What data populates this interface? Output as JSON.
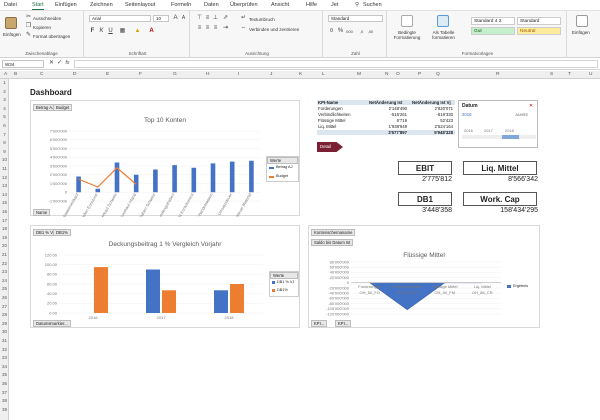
{
  "menu": [
    "Datei",
    "Start",
    "Einfügen",
    "Zeichnen",
    "Seitenlayout",
    "Formeln",
    "Daten",
    "Überprüfen",
    "Ansicht",
    "Hilfe",
    "Jet"
  ],
  "search": "Suchen",
  "ribbon": {
    "paste": "Einfügen",
    "cut": "Ausschneiden",
    "copy": "Kopieren",
    "format_painter": "Format übertragen",
    "clipboard": "Zwischenablage",
    "font": "Arial",
    "font_size": "10",
    "font_group": "Schriftart",
    "wrap": "Textumbruch",
    "merge": "Verbinden und zentrieren",
    "alignment": "Ausrichtung",
    "number_format": "Standard",
    "number": "Zahl",
    "cond_format": "Bedingte Formatierung",
    "as_table": "Als Tabelle formatieren",
    "styles": [
      "Standard 4 2",
      "Standard",
      "Gut",
      "Neutral"
    ],
    "styles_group": "Formatvorlagen",
    "insert": "Einfügen"
  },
  "name_box": "W34",
  "columns": [
    "A",
    "B",
    "C",
    "D",
    "E",
    "F",
    "G",
    "H",
    "I",
    "J",
    "K",
    "L",
    "M",
    "N",
    "O",
    "P",
    "Q",
    "R",
    "S",
    "T",
    "U"
  ],
  "rows": [
    "1",
    "2",
    "3",
    "4",
    "5",
    "6",
    "7",
    "8",
    "9",
    "10",
    "11",
    "12",
    "13",
    "14",
    "15",
    "16",
    "17",
    "18",
    "19",
    "20",
    "21",
    "22",
    "23",
    "24",
    "25",
    "26",
    "27",
    "28",
    "29",
    "30",
    "31",
    "32",
    "33",
    "34",
    "35",
    "36",
    "37",
    "38",
    "39"
  ],
  "title": "Dashboard",
  "chart1": {
    "buttons": [
      "Betrag AJ",
      "Budget"
    ],
    "title": "Top 10 Konten",
    "legend_title": "Werte",
    "legend": [
      "Betrag AJ",
      "Budget"
    ],
    "filter": "Name",
    "chart_data": {
      "type": "bar",
      "categories": [
        "Handelswareneinkauf",
        "Kostenstellen Eurozone",
        "Warenverkauf Schweiz",
        "Warenverkauf Inland",
        "Kundenguthaben Schweiz",
        "Bank Kundenguthaben",
        "Umsatz Kontokorrent",
        "Vorräte Handelswaren",
        "Umsatzsteuer",
        "Vorsteuer Material"
      ],
      "yticks": [
        "7'000'000",
        "6'000'000",
        "5'000'000",
        "4'000'000",
        "3'000'000",
        "2'000'000",
        "1'000'000",
        "0",
        "-1'000'000"
      ],
      "series": [
        {
          "name": "Betrag AJ",
          "type": "bar",
          "values": [
            1800000,
            400000,
            3400000,
            2000000,
            2600000,
            3100000,
            2800000,
            3300000,
            3500000,
            3600000
          ]
        },
        {
          "name": "Budget",
          "type": "line",
          "values": [
            1500000,
            600000,
            2800000,
            900000,
            null,
            null,
            null,
            null,
            null,
            null
          ]
        }
      ],
      "ylim": [
        -1000000,
        7000000
      ]
    }
  },
  "pivot": {
    "headers": [
      "KPI-Name",
      "NetÄnderung Ist",
      "NetÄnderung Ist Vj"
    ],
    "rows": [
      [
        "Forderungen",
        "2'148'490",
        "2'820'071"
      ],
      [
        "Verbindlichkeiten",
        "-516'261",
        "-619'330"
      ],
      [
        "Flüssige Mittel",
        "6'719",
        "52'423"
      ],
      [
        "Liq. Mittel",
        "1'938'949",
        "2'524'164"
      ]
    ],
    "total": [
      "",
      "3'577'897",
      "5'948'328"
    ]
  },
  "detail": "Detail",
  "date_slicer": {
    "title": "Datum",
    "value": "2018",
    "level": "JAHRE",
    "years": [
      "2016",
      "2017",
      "2018"
    ]
  },
  "kpis": [
    {
      "label": "EBIT",
      "value": "2'775'812"
    },
    {
      "label": "Liq. Mittel",
      "value": "8'566'342"
    },
    {
      "label": "DB1",
      "value": "3'448'358"
    },
    {
      "label": "Work. Cap",
      "value": "158'434'295"
    }
  ],
  "chart2": {
    "buttons": [
      "DB1 % VJ",
      "DB1%"
    ],
    "title": "Deckungsbeitrag 1 % Vergleich Vorjahr",
    "legend_title": "Werte",
    "legend": [
      "DB1 % VJ",
      "DB1%"
    ],
    "filter": "Datumsmarkier...",
    "chart_data": {
      "type": "bar",
      "categories": [
        "2016",
        "2017",
        "2018"
      ],
      "yticks": [
        "120.00",
        "100.00",
        "80.00",
        "60.00",
        "40.00",
        "20.00",
        "0.00"
      ],
      "series": [
        {
          "name": "DB1 % VJ",
          "values": [
            null,
            90,
            47
          ]
        },
        {
          "name": "DB1%",
          "values": [
            95,
            47,
            60
          ]
        }
      ],
      "ylim": [
        0,
        120
      ]
    }
  },
  "chart3": {
    "buttons": [
      "Kontenschemaname",
      "Saldo bis Datum Ist"
    ],
    "title": "Flüssige Mittel",
    "legend": [
      "Ergebnis"
    ],
    "filters": [
      "KPI...",
      "KPI..."
    ],
    "chart_data": {
      "type": "area",
      "categories": [
        "Forderungen",
        "Verbindlichkeiten",
        "Flüssige Mittel",
        "Liq. Mittel"
      ],
      "sublabels": [
        "OH_50_FO",
        "OH_30_VB",
        "OH_50_FM",
        "OH_88_CR"
      ],
      "yticks": [
        "80'000'000",
        "60'000'000",
        "40'000'000",
        "20'000'000",
        "0",
        "-20'000'000",
        "-40'000'000",
        "-60'000'000",
        "-80'000'000",
        "-100'000'000",
        "-120'000'000"
      ],
      "values": [
        0,
        -104000000,
        0,
        0
      ],
      "ylim": [
        -120000000,
        80000000
      ]
    }
  }
}
